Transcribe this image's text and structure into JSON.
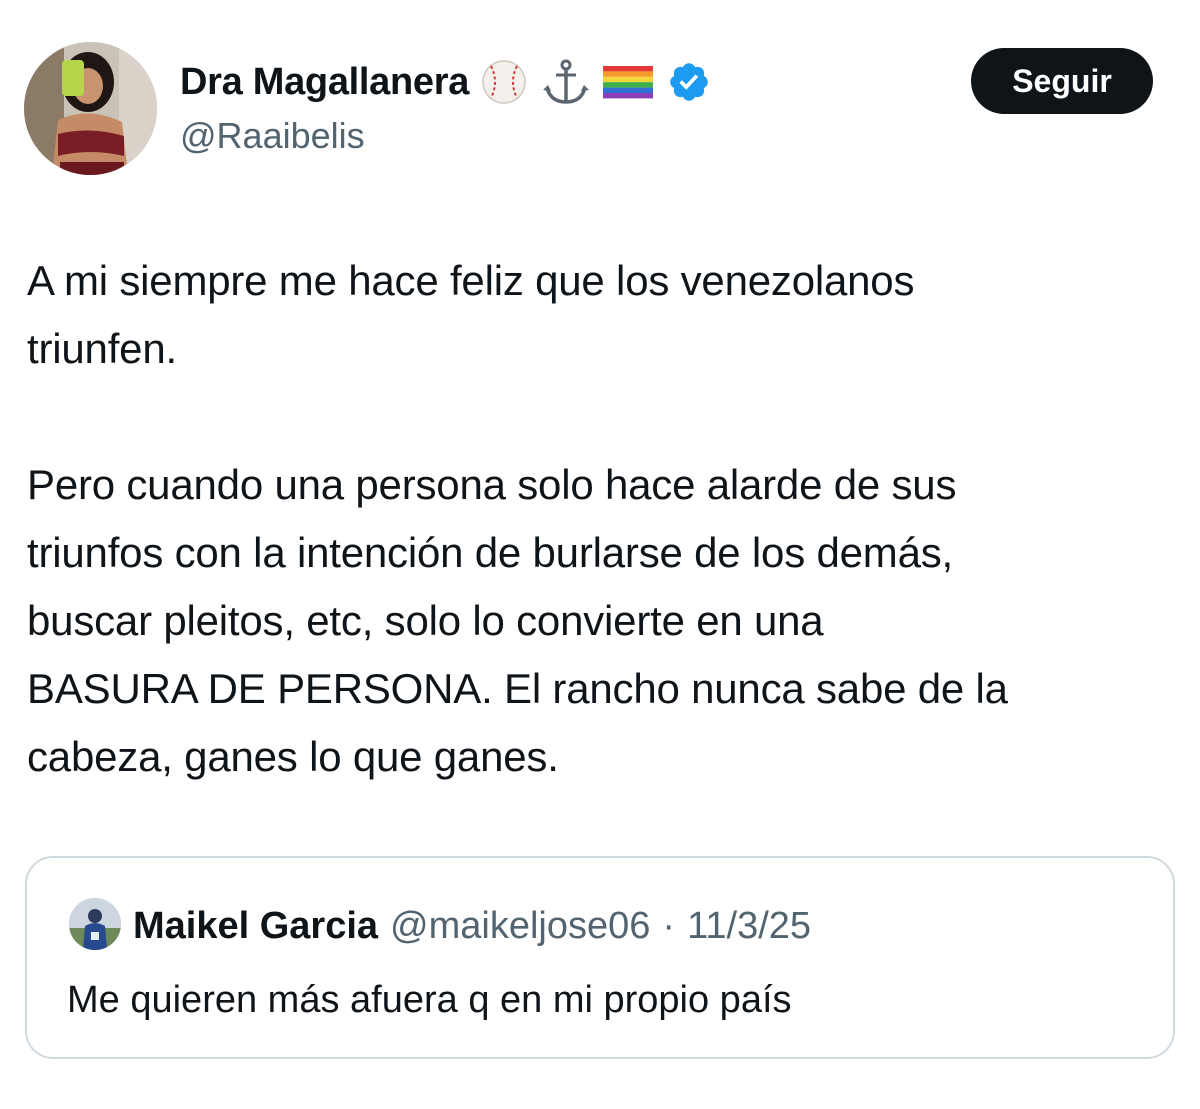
{
  "author": {
    "display_name": "Dra Magallanera",
    "handle": "@Raaibelis",
    "name_emojis": [
      "baseball-icon",
      "anchor-icon",
      "rainbow-flag-icon"
    ],
    "verified_color": "#1d9bf0"
  },
  "follow_button": {
    "label": "Seguir"
  },
  "tweet": {
    "paragraphs": [
      "A mi siempre me hace feliz que los venezolanos\ntriunfen.",
      "Pero cuando una persona solo hace alarde de sus\ntriunfos con la intención de burlarse de los demás,\nbuscar pleitos, etc, solo lo convierte en una\nBASURA DE PERSONA. El rancho nunca sabe de la\ncabeza, ganes lo que ganes."
    ]
  },
  "quoted_tweet": {
    "display_name": "Maikel Garcia",
    "handle": "@maikeljose06",
    "separator": "·",
    "date": "11/3/25",
    "text": "Me quieren más afuera q en mi propio país"
  },
  "colors": {
    "text_primary": "#0f1419",
    "text_secondary": "#536471",
    "button_bg": "#0f1419",
    "border": "#cfd9de"
  }
}
